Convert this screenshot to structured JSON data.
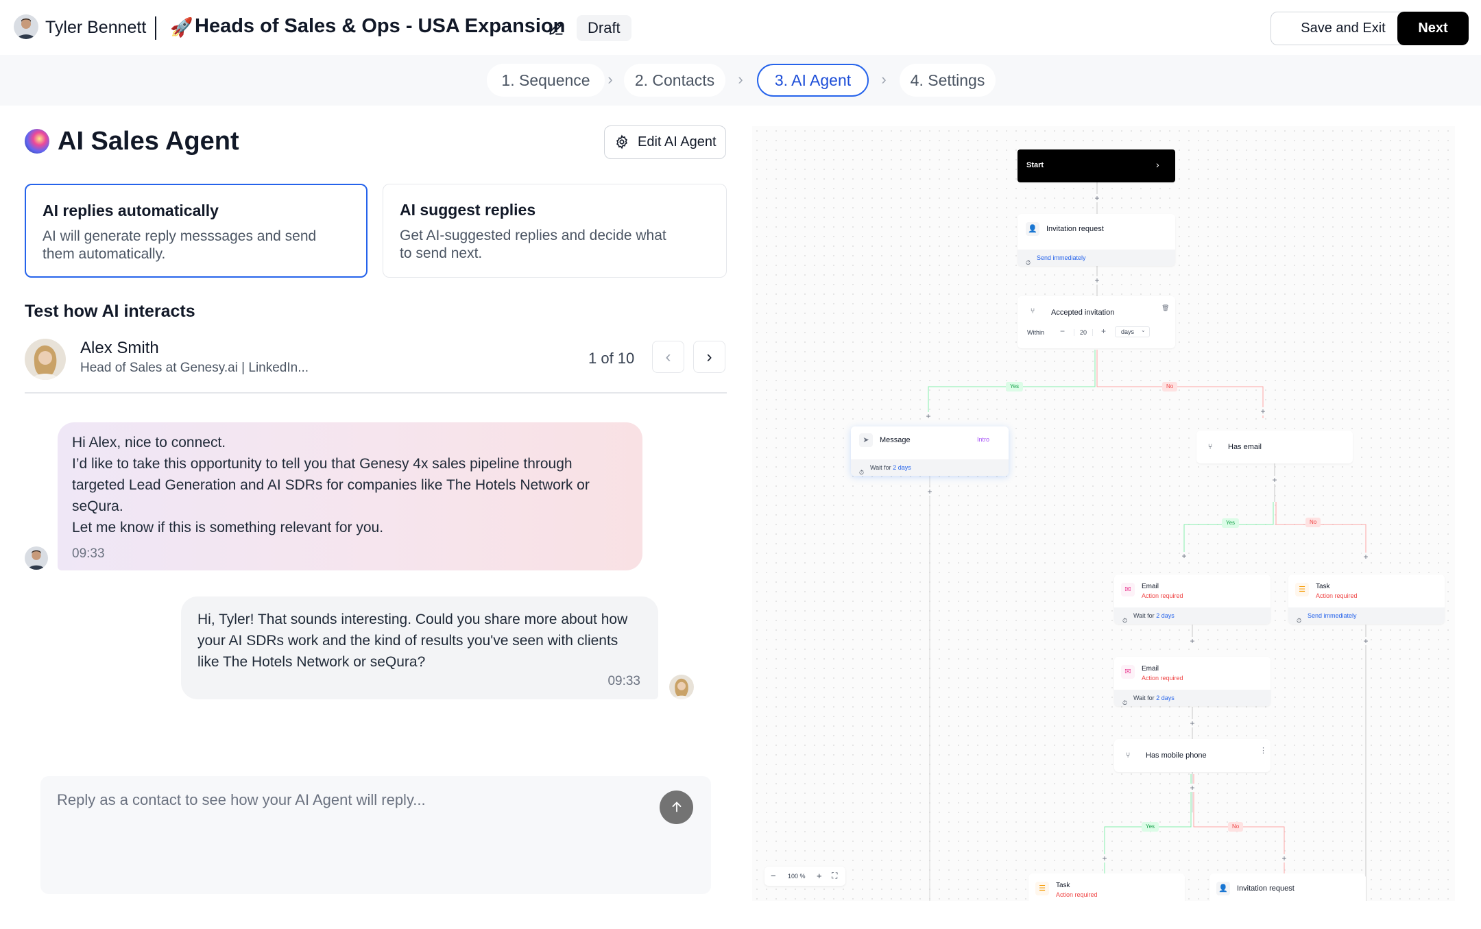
{
  "header": {
    "user_name": "Tyler Bennett",
    "campaign_emoji": "🚀",
    "campaign_title": "Heads of Sales & Ops - USA Expansion",
    "status_badge": "Draft",
    "save_exit_label": "Save and Exit",
    "next_label": "Next"
  },
  "stepper": {
    "steps": [
      {
        "label": "1. Sequence"
      },
      {
        "label": "2. Contacts"
      },
      {
        "label": "3. AI Agent"
      },
      {
        "label": "4. Settings"
      }
    ],
    "active_index": 2
  },
  "agent": {
    "title": "AI Sales Agent",
    "edit_label": "Edit AI Agent",
    "modes": [
      {
        "title": "AI replies automatically",
        "description": "AI will generate reply messsages and send them automatically."
      },
      {
        "title": "AI suggest replies",
        "description": "Get AI-suggested replies and decide what to send next."
      }
    ],
    "selected_mode_index": 0
  },
  "test": {
    "heading": "Test how AI interacts",
    "contact": {
      "name": "Alex Smith",
      "subtitle": "Head of Sales at Genesy.ai | LinkedIn..."
    },
    "pager": "1 of 10",
    "messages": [
      {
        "from": "Tyler Bennett",
        "lines": [
          "Hi Alex, nice to connect.",
          "I’d like to take this opportunity to tell you that Genesy 4x sales pipeline through targeted Lead Generation and AI SDRs for companies like The Hotels Network or seQura.",
          "Let me know if this is something relevant for you."
        ],
        "time": "09:33"
      },
      {
        "from": "Alex Smith",
        "lines": [
          "Hi, Tyler! That sounds interesting. Could you share more about how your AI SDRs work and the kind of results you've seen with clients like The Hotels Network or seQura?"
        ],
        "time": "09:33"
      }
    ],
    "reply_placeholder": "Reply as a contact to see how your AI Agent will reply..."
  },
  "flow": {
    "start_label": "Start",
    "invitation": {
      "title": "Invitation request",
      "footer": "Send immediately"
    },
    "accepted": {
      "title": "Accepted invitation",
      "within_label": "Within",
      "value": "20",
      "unit": "days"
    },
    "yes_label": "Yes",
    "no_label": "No",
    "message": {
      "title": "Message",
      "tag": "Intro",
      "footer_prefix": "Wait for",
      "footer_value": "2 days"
    },
    "has_email": {
      "title": "Has email"
    },
    "email1": {
      "title": "Email",
      "subtitle": "Action required",
      "footer_prefix": "Wait for",
      "footer_value": "2 days"
    },
    "task1": {
      "title": "Task",
      "subtitle": "Action required",
      "footer": "Send immediately"
    },
    "email2": {
      "title": "Email",
      "subtitle": "Action required",
      "footer_prefix": "Wait for",
      "footer_value": "2 days"
    },
    "has_phone": {
      "title": "Has mobile phone"
    },
    "task2": {
      "title": "Task",
      "subtitle": "Action required"
    },
    "invitation2": {
      "title": "Invitation request"
    },
    "zoom": "100 %"
  },
  "colors": {
    "accent": "#2563eb",
    "primary_button": "#000000",
    "yes": "#16a34a",
    "no": "#ef4444"
  }
}
